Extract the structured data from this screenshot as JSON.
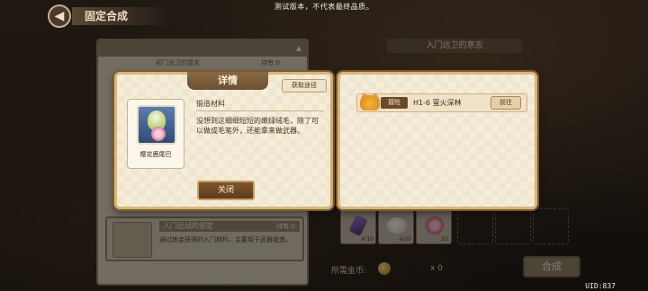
{
  "banner": "测试版本，不代表最终品质。",
  "header": {
    "title": "固定合成"
  },
  "list_panel": {
    "ghost_title": "初门远卫的意志",
    "ghost_count": "持有:0",
    "item": {
      "title": "入门近战的坚定",
      "count": "持有:0",
      "desc": "通过炼金获得的入门材料，主要用于武器锻造。"
    }
  },
  "craft_panel": {
    "title": "入门远卫的意志",
    "slots": [
      {
        "icon": "purple-gem-icon",
        "count": "4/10"
      },
      {
        "icon": "white-egg-icon",
        "count": "4/29"
      },
      {
        "icon": "pink-flower-icon",
        "count": "3/1"
      }
    ],
    "gold_label": "所需金币:",
    "gold_amount": "x 0",
    "craft_button": "合成"
  },
  "detail": {
    "tab_title": "详情",
    "source_button": "获取途径",
    "item_name": "樱花鹿尾巴",
    "category": "锻造材料",
    "description": "没想到这细细短短的嫩绿绒毛，除了可以做成毛笔外，还能拿来做武器。",
    "close_button": "关闭"
  },
  "source": {
    "rows": [
      {
        "type": "冒险",
        "stage": "H1-6 萤火深林",
        "button": "前往"
      }
    ]
  },
  "uid": "UID:837",
  "colors": {
    "popup_bg": "#f5edda",
    "popup_border": "#d7b77a",
    "button_brown": "#6a4a2a"
  }
}
